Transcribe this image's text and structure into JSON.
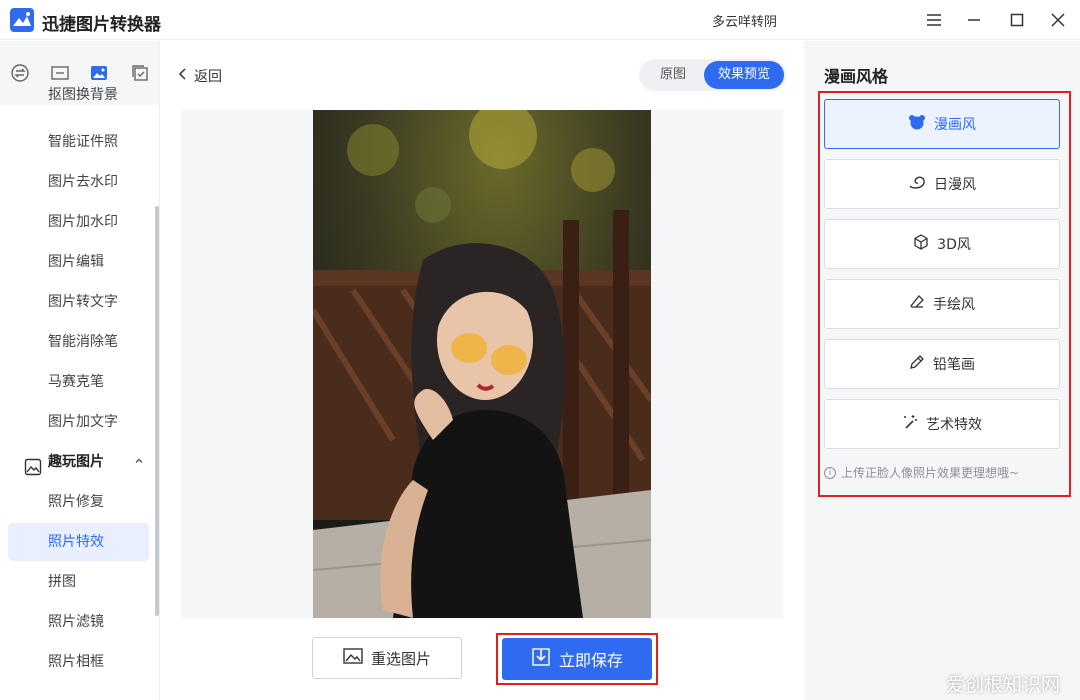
{
  "app": {
    "title": "迅捷图片转换器",
    "weather": "多云咩转阴"
  },
  "sidebar": {
    "items": [
      {
        "label": "抠图换背景"
      },
      {
        "label": "智能证件照"
      },
      {
        "label": "图片去水印"
      },
      {
        "label": "图片加水印"
      },
      {
        "label": "图片编辑"
      },
      {
        "label": "图片转文字"
      },
      {
        "label": "智能消除笔"
      },
      {
        "label": "马赛克笔"
      },
      {
        "label": "图片加文字"
      }
    ],
    "group": {
      "label": "趣玩图片"
    },
    "sub_items": [
      {
        "label": "照片修复"
      },
      {
        "label": "照片特效"
      },
      {
        "label": "拼图"
      },
      {
        "label": "照片滤镜"
      },
      {
        "label": "照片相框"
      }
    ]
  },
  "main": {
    "back_label": "返回",
    "toggle": {
      "original": "原图",
      "preview": "效果预览"
    },
    "reselect_label": "重选图片",
    "save_label": "立即保存"
  },
  "panel": {
    "title": "漫画风格",
    "styles": [
      {
        "label": "漫画风",
        "icon": "bear-icon"
      },
      {
        "label": "日漫风",
        "icon": "swirl-icon"
      },
      {
        "label": "3D风",
        "icon": "cube-icon"
      },
      {
        "label": "手绘风",
        "icon": "eraser-icon"
      },
      {
        "label": "铅笔画",
        "icon": "pencil-icon"
      },
      {
        "label": "艺术特效",
        "icon": "magic-wand-icon"
      }
    ],
    "hint": "上传正脸人像照片效果更理想哦~"
  },
  "watermark": "爱创根知识网",
  "colors": {
    "accent": "#2f6bf0",
    "highlight": "#e02020"
  }
}
